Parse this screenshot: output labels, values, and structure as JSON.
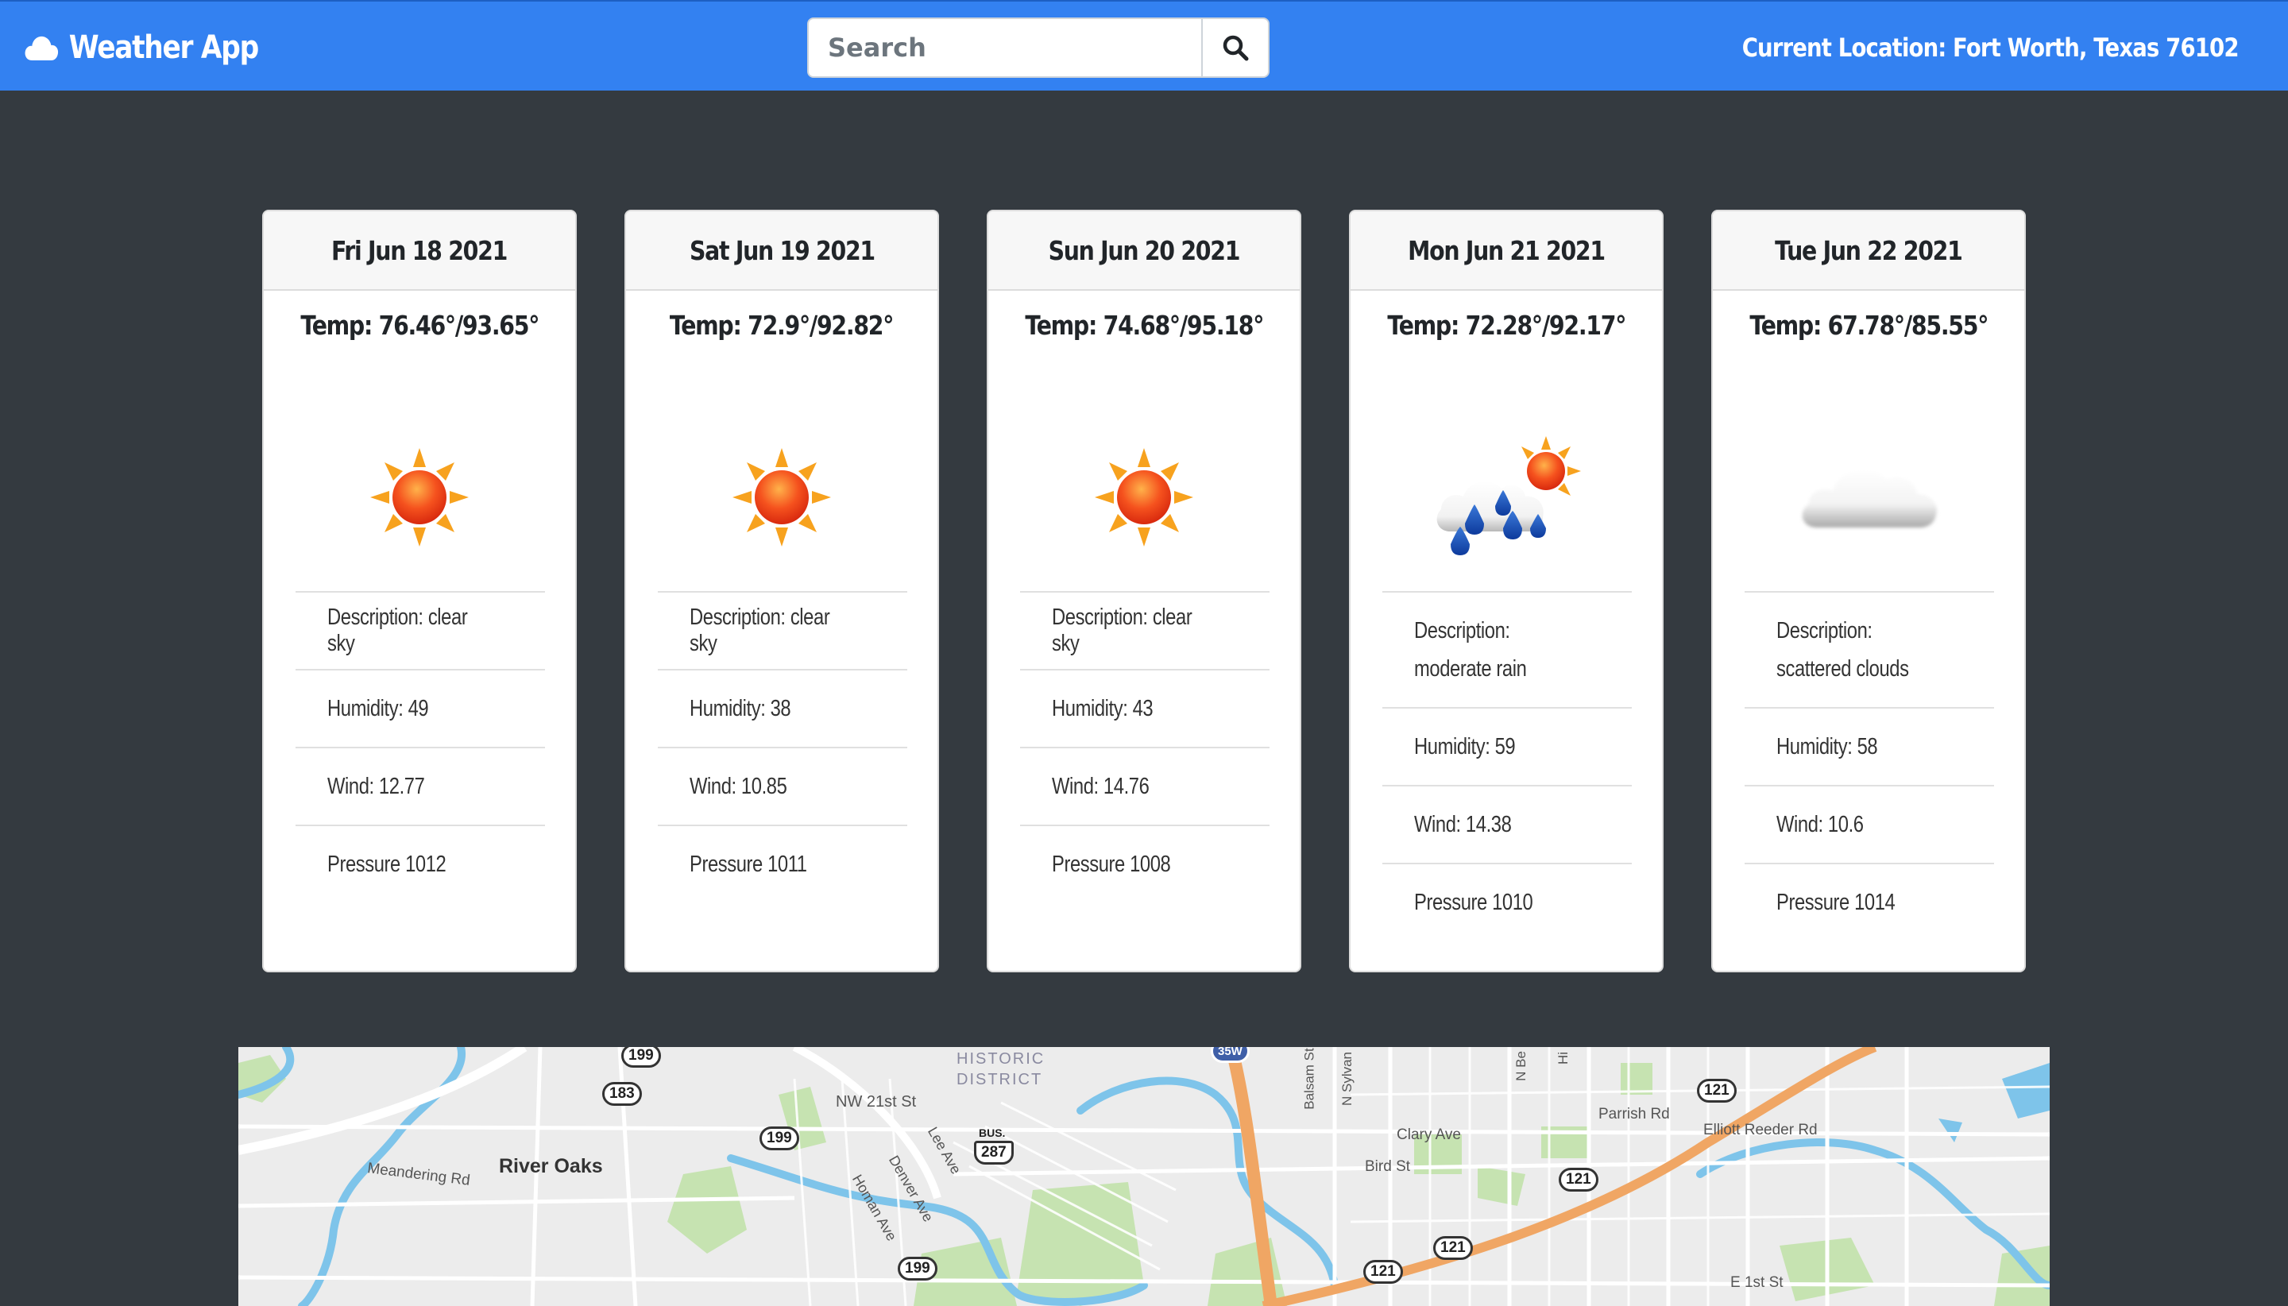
{
  "app": {
    "title": "Weather App",
    "brand_icon": "cloud-icon"
  },
  "search": {
    "placeholder": "Search",
    "value": "",
    "button_icon": "search-icon"
  },
  "location": {
    "label": "Current Location:",
    "value": "Fort Worth, Texas 76102"
  },
  "colors": {
    "navbar": "#3381f1",
    "page_background": "#343a40",
    "card_background": "#ffffff",
    "card_header": "#f7f7f7"
  },
  "forecast": [
    {
      "date": "Fri Jun 18 2021",
      "temp": "Temp: 76.46°/93.65°",
      "icon": "sun-icon",
      "description": "Description: clear sky",
      "humidity": "Humidity: 49",
      "wind": "Wind: 12.77",
      "pressure": "Pressure 1012"
    },
    {
      "date": "Sat Jun 19 2021",
      "temp": "Temp: 72.9°/92.82°",
      "icon": "sun-icon",
      "description": "Description: clear sky",
      "humidity": "Humidity: 38",
      "wind": "Wind: 10.85",
      "pressure": "Pressure 1011"
    },
    {
      "date": "Sun Jun 20 2021",
      "temp": "Temp: 74.68°/95.18°",
      "icon": "sun-icon",
      "description": "Description: clear sky",
      "humidity": "Humidity: 43",
      "wind": "Wind: 14.76",
      "pressure": "Pressure 1008"
    },
    {
      "date": "Mon Jun 21 2021",
      "temp": "Temp: 72.28°/92.17°",
      "icon": "rain-cloud-sun-icon",
      "description": "Description: moderate rain",
      "humidity": "Humidity: 59",
      "wind": "Wind: 14.38",
      "pressure": "Pressure 1010"
    },
    {
      "date": "Tue Jun 22 2021",
      "temp": "Temp: 67.78°/85.55°",
      "icon": "cloud-icon",
      "description": "Description: scattered clouds",
      "humidity": "Humidity: 58",
      "wind": "Wind: 10.6",
      "pressure": "Pressure 1014"
    }
  ],
  "map": {
    "labels": {
      "river_oaks": "River Oaks",
      "meandering": "Meandering Rd",
      "historic": "HISTORIC",
      "district": "DISTRICT",
      "nw21": "NW 21st St",
      "lee": "Lee Ave",
      "denver": "Denver Ave",
      "homan": "Homan Ave",
      "balsam": "Balsam St",
      "nsylvan": "N Sylvan",
      "nbe": "N Be",
      "hi": "Hi",
      "clary": "Clary Ave",
      "bird": "Bird St",
      "parrish": "Parrish Rd",
      "elliott": "Elliott Reeder Rd",
      "e1st": "E 1st St",
      "bus": "BUS."
    },
    "shields": {
      "s199a": "199",
      "s183": "183",
      "s199b": "199",
      "s287": "287",
      "s199c": "199",
      "s35w": "35W",
      "s121a": "121",
      "s121b": "121",
      "s121c": "121",
      "s121d": "121"
    }
  }
}
